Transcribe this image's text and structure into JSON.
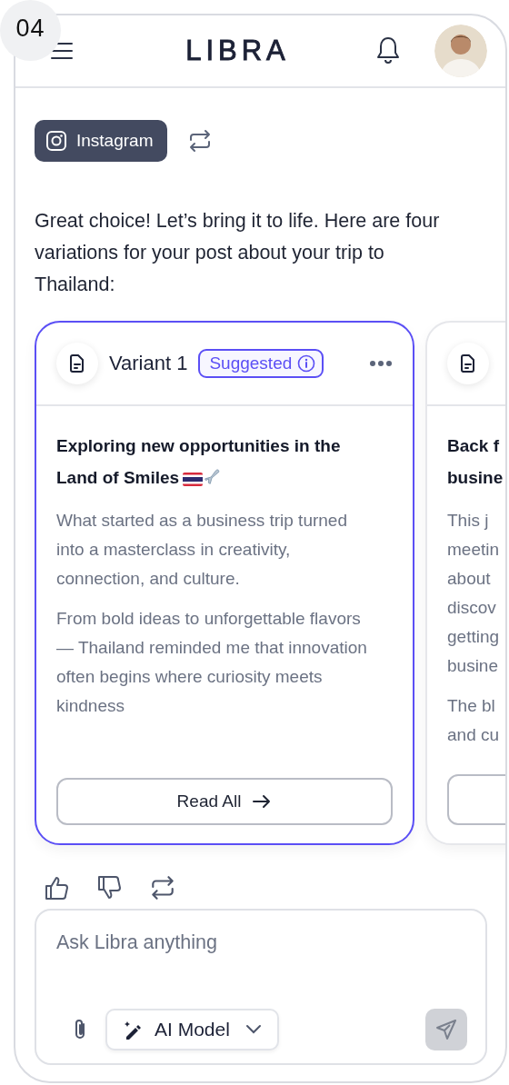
{
  "screen_number": "04",
  "header": {
    "logo": "LIBRA"
  },
  "platform": {
    "label": "Instagram"
  },
  "message": "Great choice! Let’s bring it to life. Here are four variations for your post about your trip to Thailand:",
  "variants": [
    {
      "kind": "full",
      "selected": true,
      "title": "Variant 1",
      "badge": "Suggested",
      "heading": "Exploring new opportunities in the Land of Smiles",
      "paragraphs": [
        "What started as a business trip turned into a masterclass in creativity, connection, and culture.",
        "From bold ideas to unforgettable flavors — Thailand reminded me that innovation often begins where curiosity meets kindness"
      ],
      "button": "Read All"
    },
    {
      "kind": "cut",
      "selected": false,
      "heading_lines": [
        "Back f",
        "busine"
      ],
      "paragraph_lines": [
        [
          "This j",
          "meetin",
          "about",
          "discov",
          "getting",
          "busine"
        ],
        [
          "The bl",
          "and cu"
        ]
      ]
    }
  ],
  "composer": {
    "placeholder": "Ask Libra anything",
    "model_button": "AI Model"
  }
}
